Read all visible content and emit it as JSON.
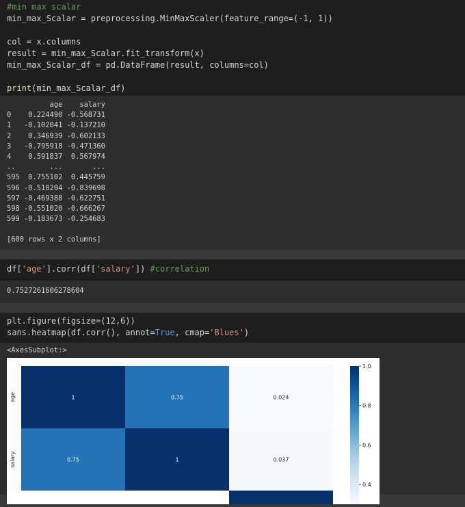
{
  "cell1": {
    "lines": [
      {
        "segments": [
          {
            "t": "#min max scalar",
            "c": "comment"
          }
        ]
      },
      {
        "segments": [
          {
            "t": "min_max_Scalar = preprocessing.MinMaxScaler(feature_range=(-1, 1))",
            "c": "plain"
          }
        ]
      },
      {
        "segments": []
      },
      {
        "segments": [
          {
            "t": "col = x.columns",
            "c": "plain"
          }
        ]
      },
      {
        "segments": [
          {
            "t": "result = min_max_Scalar.fit_transform(x)",
            "c": "plain"
          }
        ]
      },
      {
        "segments": [
          {
            "t": "min_max_Scalar_df = pd.DataFrame(result, columns=col)",
            "c": "plain"
          }
        ]
      },
      {
        "segments": []
      },
      {
        "segments": [
          {
            "t": "print",
            "c": "fn"
          },
          {
            "t": "(min_max_Scalar_df)",
            "c": "plain"
          }
        ]
      }
    ]
  },
  "output1": {
    "lines": [
      "          age    salary",
      "0    0.224490 -0.568731",
      "1   -0.102041 -0.137210",
      "2    0.346939 -0.602133",
      "3   -0.795918 -0.471360",
      "4    0.591837  0.567974",
      "..        ...       ...",
      "595  0.755102  0.445759",
      "596 -0.510204 -0.839698",
      "597 -0.469388 -0.622751",
      "598 -0.551020 -0.666267",
      "599 -0.183673 -0.254683",
      "",
      "[600 rows x 2 columns]"
    ]
  },
  "cell2": {
    "lines": [
      {
        "segments": [
          {
            "t": "df[",
            "c": "plain"
          },
          {
            "t": "'age'",
            "c": "str"
          },
          {
            "t": "].corr(df[",
            "c": "plain"
          },
          {
            "t": "'salary'",
            "c": "str"
          },
          {
            "t": "]) ",
            "c": "plain"
          },
          {
            "t": "#correlation",
            "c": "comment"
          }
        ]
      }
    ]
  },
  "output2": {
    "lines": [
      "0.7527261606278604"
    ]
  },
  "cell3": {
    "lines": [
      {
        "segments": [
          {
            "t": "plt.figure(figsize=(12,6))",
            "c": "plain"
          }
        ]
      },
      {
        "segments": [
          {
            "t": "sans.heatmap(df.corr(), annot=",
            "c": "plain"
          },
          {
            "t": "True",
            "c": "kw"
          },
          {
            "t": ", cmap=",
            "c": "plain"
          },
          {
            "t": "'Blues'",
            "c": "str"
          },
          {
            "t": ")",
            "c": "plain"
          }
        ]
      }
    ]
  },
  "output3": {
    "axes_label": "<AxesSubplot:>"
  },
  "colors": {
    "comment": "#6a9955",
    "fn": "#dcdcaa",
    "str": "#ce9178",
    "kw": "#569cd6",
    "plain": "#d4d4d4"
  },
  "chart_data": {
    "type": "heatmap",
    "cmap": "Blues",
    "rows": [
      "age",
      "salary"
    ],
    "columns": [
      "",
      "",
      ""
    ],
    "values": [
      [
        1,
        0.75,
        0.024
      ],
      [
        0.75,
        1,
        0.037
      ]
    ],
    "annotations": [
      [
        "1",
        "0.75",
        "0.024"
      ],
      [
        "0.75",
        "1",
        "0.037"
      ]
    ],
    "colorbar_ticks": [
      "1.0",
      "0.8",
      "0.6",
      "0.4"
    ],
    "colorbar_values": [
      1.0,
      0.8,
      0.6,
      0.4
    ],
    "vrange": [
      0.024,
      1.0
    ],
    "truncated_third_row_first_visible_value": 1
  }
}
